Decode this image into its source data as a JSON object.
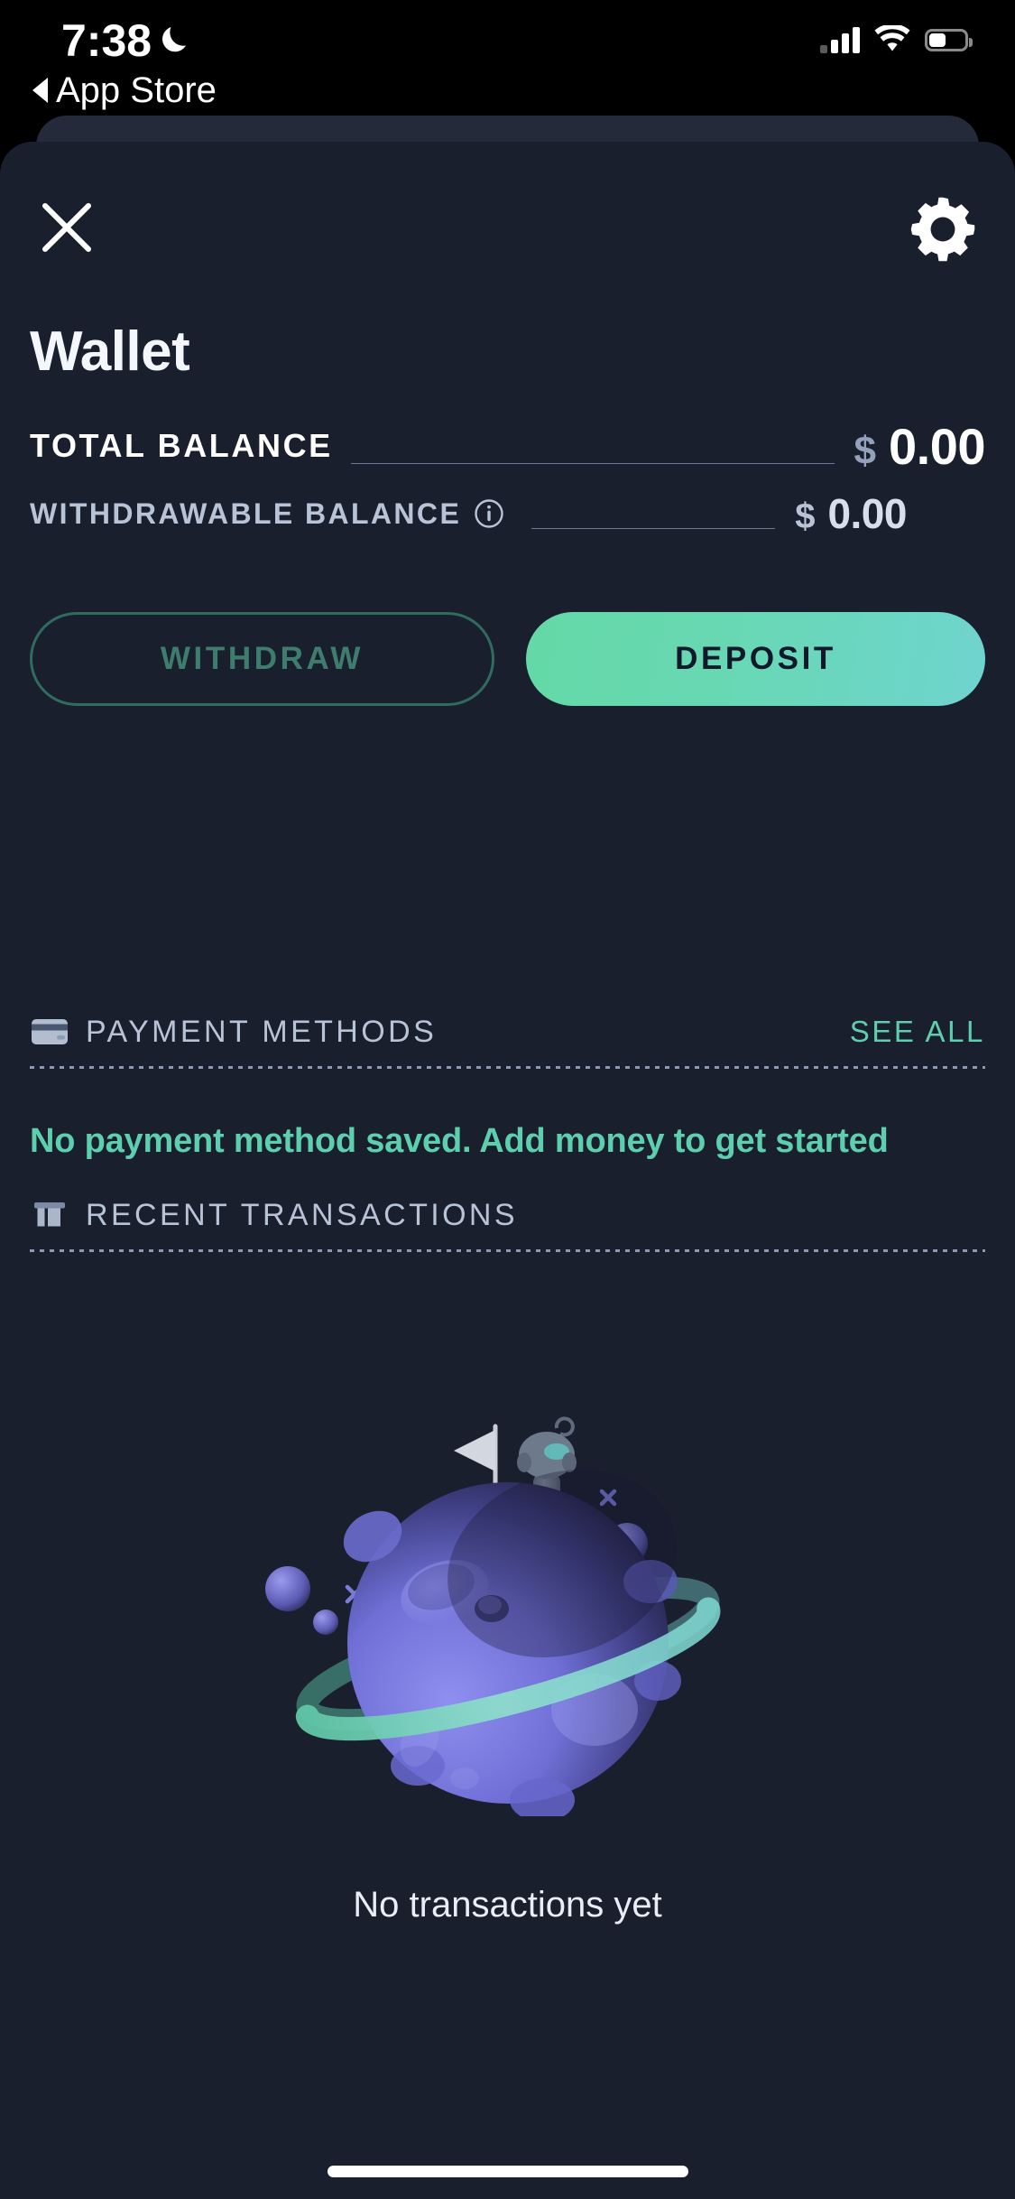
{
  "status_bar": {
    "time": "7:38",
    "dnd_icon": "moon-icon",
    "back_label": "App Store",
    "signal_icon": "cellular-signal-icon",
    "wifi_icon": "wifi-icon",
    "battery_icon": "battery-icon",
    "battery_level_pct": 48
  },
  "header": {
    "close_icon": "close-x-icon",
    "settings_icon": "gear-icon",
    "title": "Wallet"
  },
  "balances": {
    "total": {
      "label": "TOTAL BALANCE",
      "currency": "$",
      "value": "0.00"
    },
    "withdrawable": {
      "label": "WITHDRAWABLE BALANCE",
      "info_icon": "info-circle-icon",
      "currency": "$",
      "value": "0.00"
    }
  },
  "actions": {
    "withdraw_label": "WITHDRAW",
    "withdraw_disabled": true,
    "deposit_label": "DEPOSIT"
  },
  "payment_methods": {
    "icon": "credit-card-icon",
    "title": "PAYMENT METHODS",
    "see_all_label": "SEE ALL",
    "empty_message": "No payment method saved. Add money to get started"
  },
  "recent_transactions": {
    "icon": "receipt-icon",
    "title": "RECENT TRANSACTIONS",
    "illustration": "planet-with-astronaut-illustration",
    "empty_message": "No transactions yet"
  },
  "colors": {
    "background": "#000000",
    "sheet_background": "#1a1f2e",
    "sheet_behind": "#242a3a",
    "accent_mint": "#5ecfae",
    "muted_blue": "#b8c3d6",
    "deposit_gradient_start": "#64d9a6",
    "deposit_gradient_end": "#6fd4cf",
    "withdraw_border": "#2f6b5e",
    "planet_purple": "#6f6fd6",
    "planet_ring_mint": "#7fd9bf"
  },
  "home_indicator": "home-indicator"
}
